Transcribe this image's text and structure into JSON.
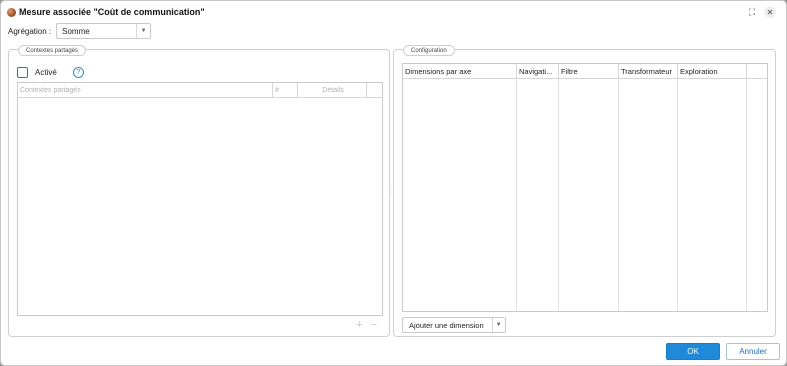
{
  "dialog": {
    "title": "Mesure associée \"Coût de communication\"",
    "expand_icon": "expand-icon",
    "close_icon": "close-icon"
  },
  "aggregation": {
    "label": "Agrégation :",
    "value": "Somme"
  },
  "shared_contexts": {
    "legend": "Contextes partagés",
    "active_label": "Activé",
    "active_checked": false,
    "columns": [
      "Contextes partagés",
      "#",
      "Détails",
      ""
    ]
  },
  "configuration": {
    "legend": "Configuration",
    "columns": [
      "Dimensions par axe",
      "Navigati...",
      "Filtre",
      "Transformateur",
      "Exploration",
      ""
    ],
    "add_dimension_label": "Ajouter une dimension"
  },
  "buttons": {
    "ok": "OK",
    "cancel": "Annuler"
  },
  "colors": {
    "accent": "#1f8bd8",
    "checkbox_border": "#3a6ea5"
  }
}
